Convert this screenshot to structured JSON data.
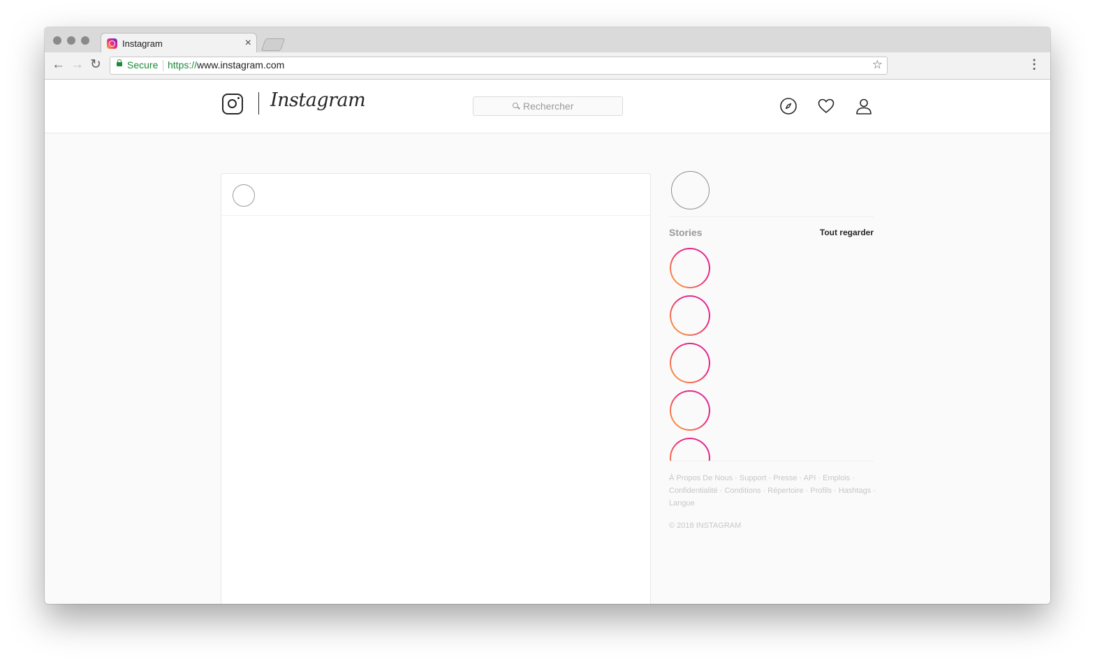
{
  "browser": {
    "tab_title": "Instagram",
    "tab_close": "×",
    "secure_label": "Secure",
    "url_scheme": "https://",
    "url_host": "www.instagram.com",
    "back": "←",
    "forward": "→",
    "reload": "↻",
    "star": "☆",
    "menu": "⋮"
  },
  "header": {
    "brand": "Instagram",
    "search_placeholder": "Rechercher",
    "icons": [
      "compass-icon",
      "heart-icon",
      "user-icon"
    ]
  },
  "sidebar": {
    "stories_title": "Stories",
    "see_all": "Tout regarder",
    "story_count_visible": 5,
    "footer_links": [
      "À Propos De Nous",
      "Support",
      "Presse",
      "API",
      "Emplois",
      "Confidentialité",
      "Conditions",
      "Répertoire",
      "Profils",
      "Hashtags",
      "Langue"
    ],
    "copyright": "© 2018 INSTAGRAM"
  },
  "colors": {
    "story_gradient_start": "#f9b02c",
    "story_gradient_end": "#d6249f",
    "secure_green": "#1a8a3a"
  }
}
